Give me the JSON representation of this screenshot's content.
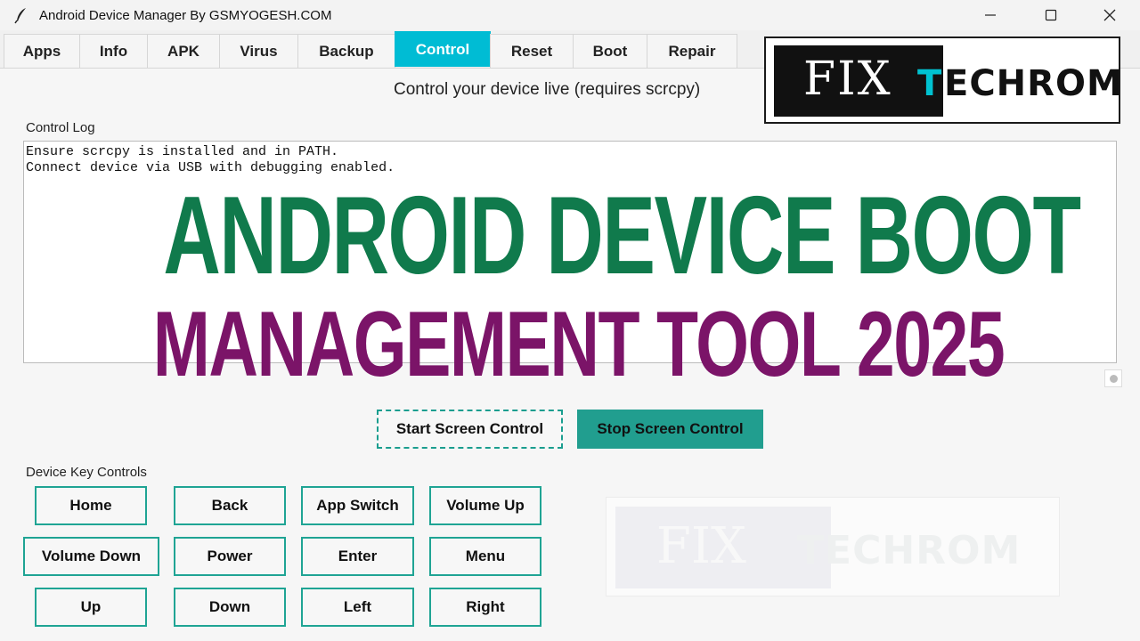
{
  "window": {
    "title": "Android Device Manager By GSMYOGESH.COM",
    "icons": {
      "app": "feather-icon",
      "minimize": "minimize-icon",
      "maximize": "maximize-icon",
      "close": "close-icon"
    }
  },
  "tabs": [
    {
      "label": "Apps",
      "active": false
    },
    {
      "label": "Info",
      "active": false
    },
    {
      "label": "APK",
      "active": false
    },
    {
      "label": "Virus",
      "active": false
    },
    {
      "label": "Backup",
      "active": false
    },
    {
      "label": "Control",
      "active": true
    },
    {
      "label": "Reset",
      "active": false
    },
    {
      "label": "Boot",
      "active": false
    },
    {
      "label": "Repair",
      "active": false
    }
  ],
  "control": {
    "subtitle": "Control your device live (requires scrcpy)",
    "log_label": "Control Log",
    "log_lines": [
      "Ensure scrcpy is installed and in PATH.",
      "Connect device via USB with debugging enabled."
    ],
    "start_label": "Start Screen Control",
    "stop_label": "Stop Screen Control",
    "keys_label": "Device Key Controls",
    "keys": [
      "Home",
      "Back",
      "App Switch",
      "Volume Up",
      "Volume Down",
      "Power",
      "Enter",
      "Menu",
      "Up",
      "Down",
      "Left",
      "Right"
    ]
  },
  "logo": {
    "part1": "FIX",
    "part2": "T",
    "part3": "ECHROM"
  },
  "watermark": {
    "part1": "FIX",
    "part2": "TECHROM"
  },
  "overlay": {
    "line1": "ANDROID DEVICE BOOT",
    "line2": "MANAGEMENT TOOL 2025"
  },
  "colors": {
    "accent": "#00bcd4",
    "button_border": "#1fa494",
    "stop_button": "#219e8f",
    "headline1": "#107a4c",
    "headline2": "#7b1468"
  }
}
